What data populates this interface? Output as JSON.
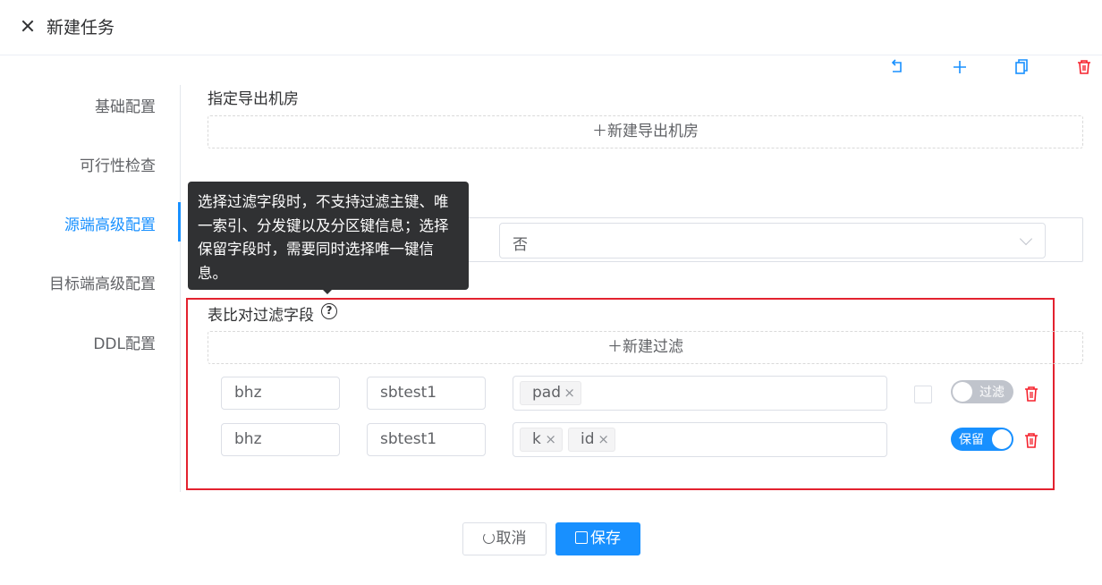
{
  "header": {
    "title": "新建任务"
  },
  "nav": {
    "items": [
      {
        "label": "基础配置",
        "active": false
      },
      {
        "label": "可行性检查",
        "active": false
      },
      {
        "label": "源端高级配置",
        "active": true
      },
      {
        "label": "目标端高级配置",
        "active": false
      },
      {
        "label": "DDL配置",
        "active": false
      }
    ]
  },
  "toolbar": {
    "icons": [
      "undo-icon",
      "plus-icon",
      "copy-icon",
      "trash-icon"
    ]
  },
  "export_room": {
    "label": "指定导出机房",
    "add_label": "＋新建导出机房"
  },
  "hidden_section": {
    "select_value": "否"
  },
  "filter_section": {
    "label": "表比对过滤字段",
    "add_label": "＋新建过滤",
    "rows": [
      {
        "db": "bhz",
        "table": "sbtest1",
        "tags": [
          "pad"
        ],
        "checkbox": false,
        "switch_label": "过滤",
        "switch_on": false
      },
      {
        "db": "bhz",
        "table": "sbtest1",
        "tags": [
          "k",
          "id"
        ],
        "checkbox": null,
        "switch_label": "保留",
        "switch_on": true
      }
    ]
  },
  "tooltip": {
    "text": "选择过滤字段时，不支持过滤主键、唯一索引、分发键以及分区键信息；选择保留字段时，需要同时选择唯一键信息。"
  },
  "footer": {
    "cancel_label": "取消",
    "save_label": "保存"
  },
  "colors": {
    "accent": "#1890ff",
    "danger": "#f5222d",
    "highlight_frame": "#e3222f"
  }
}
